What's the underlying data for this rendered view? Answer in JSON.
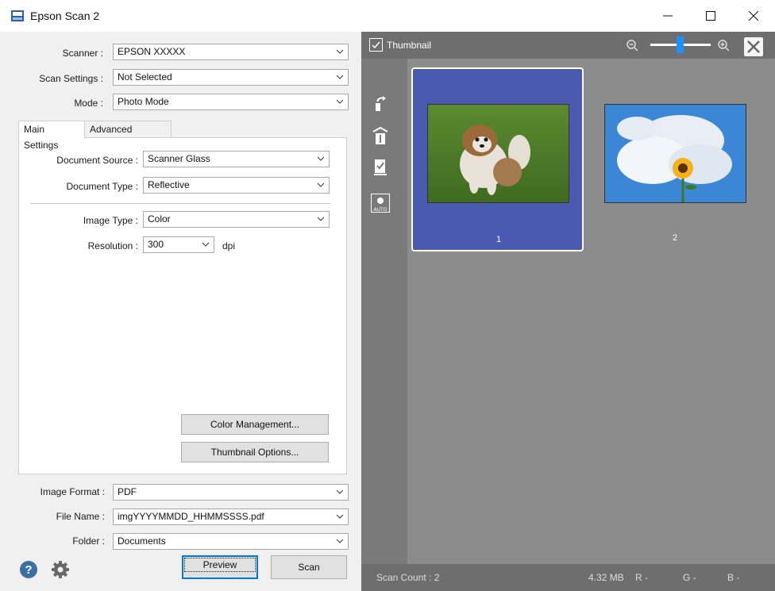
{
  "window": {
    "title": "Epson Scan 2"
  },
  "settings": {
    "scanner_label": "Scanner :",
    "scanner_value": "EPSON XXXXX",
    "scan_settings_label": "Scan Settings :",
    "scan_settings_value": "Not Selected",
    "mode_label": "Mode :",
    "mode_value": "Photo Mode"
  },
  "tabs": [
    {
      "label": "Main Settings"
    },
    {
      "label": "Advanced Settings"
    }
  ],
  "main_settings": {
    "document_source_label": "Document Source :",
    "document_source_value": "Scanner Glass",
    "document_type_label": "Document Type :",
    "document_type_value": "Reflective",
    "image_type_label": "Image Type :",
    "image_type_value": "Color",
    "resolution_label": "Resolution :",
    "resolution_value": "300",
    "resolution_unit": "dpi",
    "color_management_button": "Color Management...",
    "thumbnail_options_button": "Thumbnail Options..."
  },
  "output": {
    "image_format_label": "Image Format :",
    "image_format_value": "PDF",
    "file_name_label": "File Name :",
    "file_name_value": "imgYYYYMMDD_HHMMSSSS.pdf",
    "folder_label": "Folder :",
    "folder_value": "Documents"
  },
  "actions": {
    "preview": "Preview",
    "scan": "Scan"
  },
  "preview_panel": {
    "thumbnail_label": "Thumbnail",
    "thumbnail_checked": true,
    "thumbnails": [
      {
        "number": "1",
        "selected": true,
        "subject": "dog on grass"
      },
      {
        "number": "2",
        "selected": false,
        "subject": "sunflower against sky"
      }
    ]
  },
  "status": {
    "scan_count": "Scan Count : 2",
    "size": "4.32 MB",
    "r": "R  -",
    "g": "G  -",
    "b": "B  -"
  },
  "colors": {
    "accent": "#0078d7",
    "selected_thumb": "#4a5ab0",
    "preview_bg": "#8c8c8c"
  },
  "icons": [
    "app-icon",
    "minimize-icon",
    "maximize-icon",
    "close-icon",
    "chevron-down-icon",
    "zoom-out-icon",
    "zoom-in-icon",
    "rotate-icon",
    "deskew-icon",
    "document-check-icon",
    "auto-exposure-icon",
    "help-icon",
    "gear-icon"
  ]
}
